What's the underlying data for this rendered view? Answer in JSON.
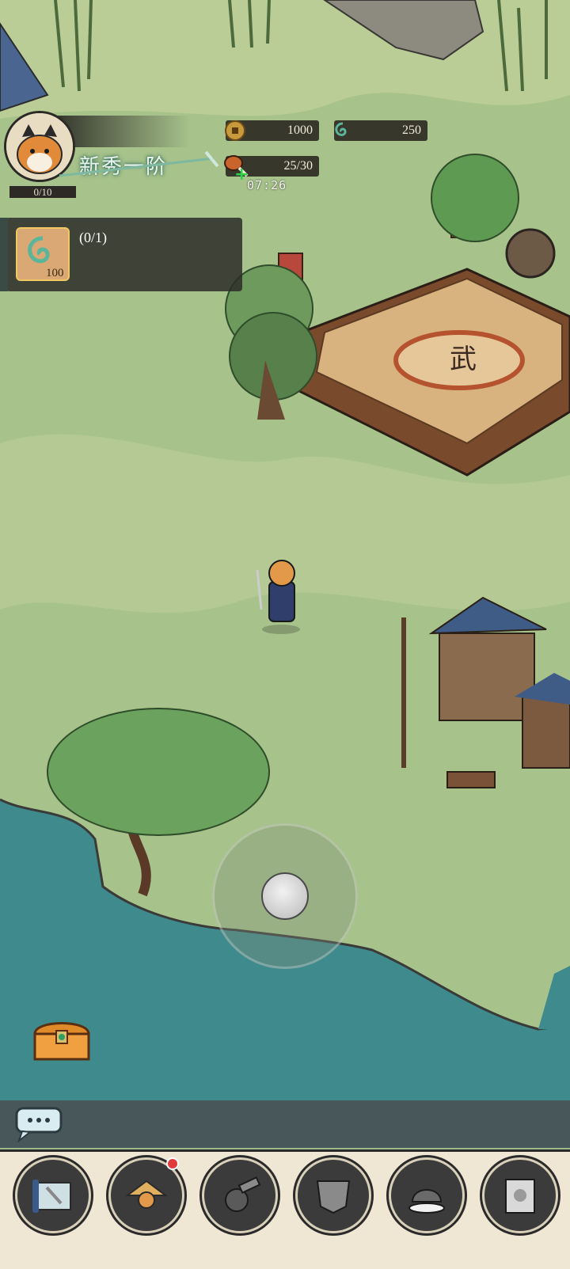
{
  "hud": {
    "copper_coins": "1000",
    "jade_currency": "250",
    "stamina": "25/30",
    "stamina_timer": "07:26",
    "rank_title": "新秀一阶",
    "exp_progress": "0/10"
  },
  "task": {
    "progress": "(0/1)",
    "reward_amount": "100"
  },
  "colors": {
    "grass": "#a9c38e",
    "water": "#3f8a8c",
    "hud_dark": "#2c2a26",
    "nav_bg": "#efe7d4",
    "notify_red": "#e23b3b"
  },
  "nav": {
    "items": [
      {
        "icon": "scroll-map-icon"
      },
      {
        "icon": "straw-hat-warrior-icon",
        "notification": true
      },
      {
        "icon": "gourd-cannon-icon"
      },
      {
        "icon": "armor-plate-icon"
      },
      {
        "icon": "helmet-cloud-icon"
      },
      {
        "icon": "quest-book-icon"
      }
    ]
  }
}
